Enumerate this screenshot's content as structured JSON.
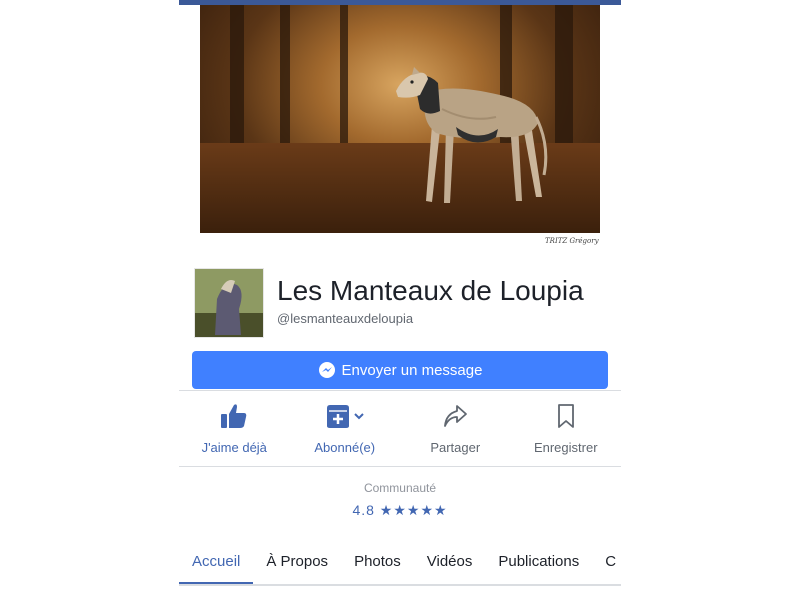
{
  "cover": {
    "credit": "TRITZ Grégory"
  },
  "page": {
    "name": "Les Manteaux de Loupia",
    "handle": "@lesmanteauxdeloupia"
  },
  "message_button": {
    "label": "Envoyer un message"
  },
  "actions": [
    {
      "label": "J'aime déjà",
      "icon": "thumbs-up-icon",
      "color": "#4267b2"
    },
    {
      "label": "Abonné(e)",
      "icon": "follow-inbox-icon",
      "color": "#4267b2"
    },
    {
      "label": "Partager",
      "icon": "share-icon",
      "color": "#606770"
    },
    {
      "label": "Enregistrer",
      "icon": "bookmark-icon",
      "color": "#606770"
    }
  ],
  "community": {
    "label": "Communauté",
    "rating": "4.8",
    "stars": "★★★★★"
  },
  "tabs": [
    {
      "label": "Accueil",
      "active": true
    },
    {
      "label": "À Propos",
      "active": false
    },
    {
      "label": "Photos",
      "active": false
    },
    {
      "label": "Vidéos",
      "active": false
    },
    {
      "label": "Publications",
      "active": false
    },
    {
      "label": "C",
      "active": false
    }
  ],
  "colors": {
    "brand": "#3b5998",
    "accent": "#4080ff",
    "link": "#4267b2"
  }
}
